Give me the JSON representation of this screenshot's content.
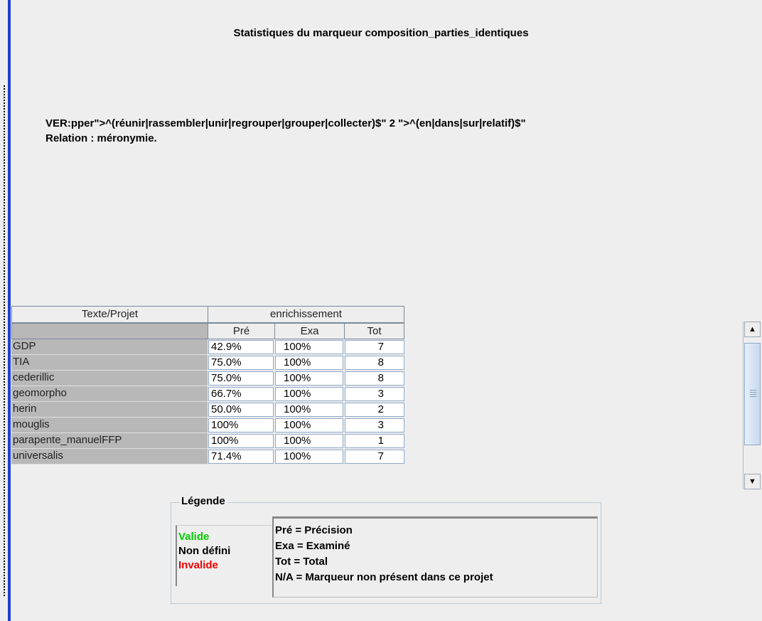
{
  "title": "Statistiques du marqueur composition_parties_identiques",
  "description": {
    "line1": "VER:pper\">^(réunir|rassembler|unir|regrouper|grouper|collecter)$\" 2 \">^(en|dans|sur|relatif)$\"",
    "line2": "Relation : méronymie."
  },
  "table": {
    "header_main": "Texte/Projet",
    "header_group": "enrichissement",
    "sub_headers": [
      "Pré",
      "Exa",
      "Tot"
    ],
    "rows": [
      {
        "name": "GDP",
        "pre": "42.9%",
        "exa": "100%",
        "tot": "7"
      },
      {
        "name": "TIA",
        "pre": "75.0%",
        "exa": "100%",
        "tot": "8"
      },
      {
        "name": "cederillic",
        "pre": "75.0%",
        "exa": "100%",
        "tot": "8"
      },
      {
        "name": "geomorpho",
        "pre": "66.7%",
        "exa": "100%",
        "tot": "3"
      },
      {
        "name": "herin",
        "pre": "50.0%",
        "exa": "100%",
        "tot": "2"
      },
      {
        "name": "mouglis",
        "pre": "100%",
        "exa": "100%",
        "tot": "3"
      },
      {
        "name": "parapente_manuelFFP",
        "pre": "100%",
        "exa": "100%",
        "tot": "1"
      },
      {
        "name": "universalis",
        "pre": "71.4%",
        "exa": "100%",
        "tot": "7"
      }
    ]
  },
  "scrollbar": {
    "up_icon": "arrow-up-icon",
    "down_icon": "arrow-down-icon",
    "up_glyph": "▲",
    "down_glyph": "▼"
  },
  "legend": {
    "title": "Légende",
    "statuses": [
      {
        "label": "Valide",
        "color": "#00cc00"
      },
      {
        "label": "Non défini",
        "color": "#000000"
      },
      {
        "label": "Invalide",
        "color": "#ee0000"
      }
    ],
    "abbreviations": [
      "Pré  = Précision",
      "Exa  = Examiné",
      "Tot  = Total",
      "N/A = Marqueur non présent dans ce projet"
    ]
  }
}
